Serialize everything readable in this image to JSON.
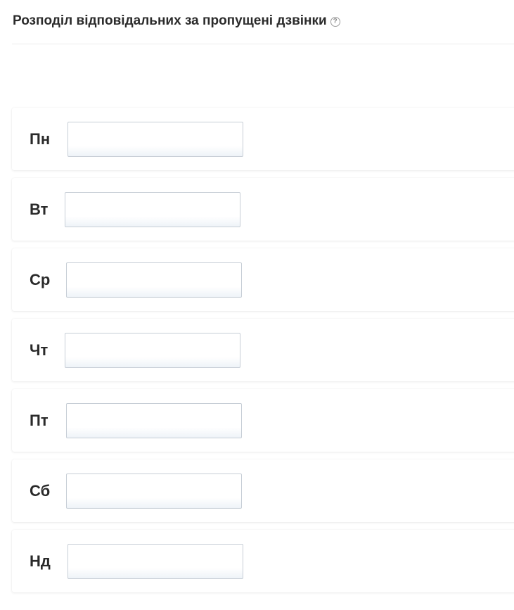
{
  "header": {
    "title": "Розподіл відповідальних за пропущені дзвінки",
    "help_icon": "?"
  },
  "days": [
    {
      "label": "Пн",
      "value": ""
    },
    {
      "label": "Вт",
      "value": ""
    },
    {
      "label": "Ср",
      "value": ""
    },
    {
      "label": "Чт",
      "value": ""
    },
    {
      "label": "Пт",
      "value": ""
    },
    {
      "label": "Сб",
      "value": ""
    },
    {
      "label": "Нд",
      "value": ""
    }
  ]
}
